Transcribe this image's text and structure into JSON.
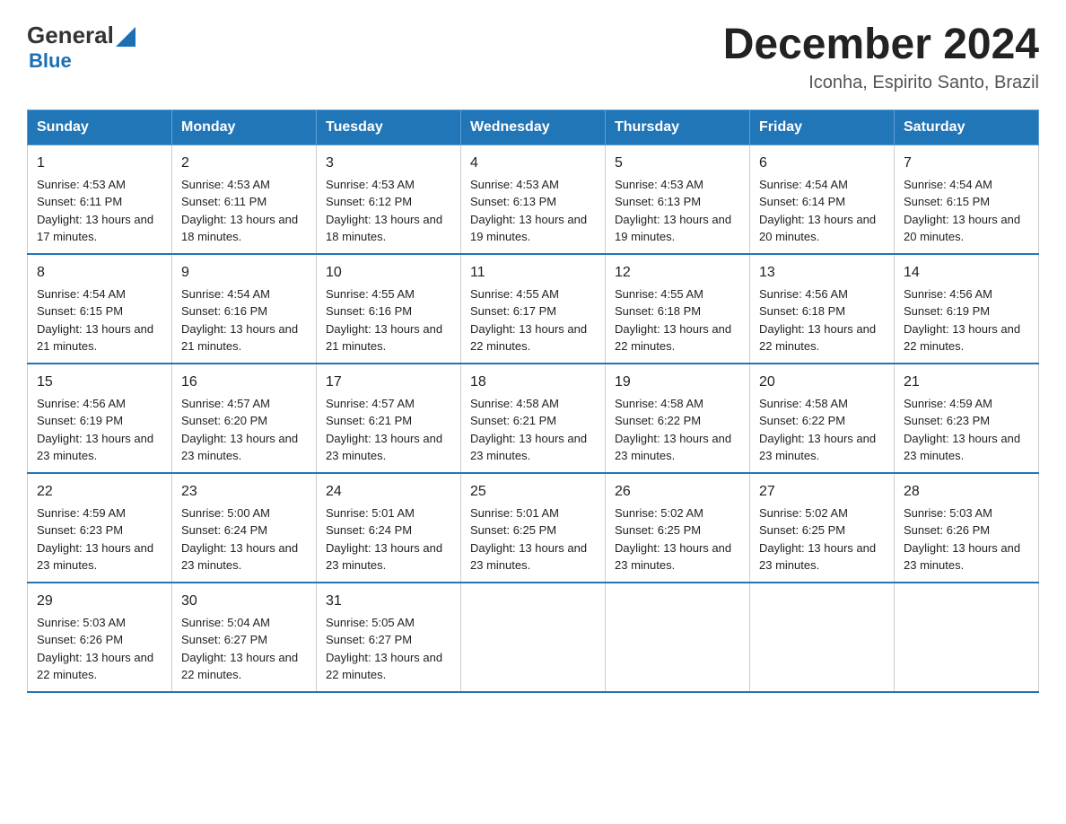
{
  "logo": {
    "general": "General",
    "blue": "Blue",
    "triangle": "▲"
  },
  "header": {
    "month_year": "December 2024",
    "location": "Iconha, Espirito Santo, Brazil"
  },
  "days_of_week": [
    "Sunday",
    "Monday",
    "Tuesday",
    "Wednesday",
    "Thursday",
    "Friday",
    "Saturday"
  ],
  "weeks": [
    [
      {
        "day": "1",
        "sunrise": "4:53 AM",
        "sunset": "6:11 PM",
        "daylight": "13 hours and 17 minutes."
      },
      {
        "day": "2",
        "sunrise": "4:53 AM",
        "sunset": "6:11 PM",
        "daylight": "13 hours and 18 minutes."
      },
      {
        "day": "3",
        "sunrise": "4:53 AM",
        "sunset": "6:12 PM",
        "daylight": "13 hours and 18 minutes."
      },
      {
        "day": "4",
        "sunrise": "4:53 AM",
        "sunset": "6:13 PM",
        "daylight": "13 hours and 19 minutes."
      },
      {
        "day": "5",
        "sunrise": "4:53 AM",
        "sunset": "6:13 PM",
        "daylight": "13 hours and 19 minutes."
      },
      {
        "day": "6",
        "sunrise": "4:54 AM",
        "sunset": "6:14 PM",
        "daylight": "13 hours and 20 minutes."
      },
      {
        "day": "7",
        "sunrise": "4:54 AM",
        "sunset": "6:15 PM",
        "daylight": "13 hours and 20 minutes."
      }
    ],
    [
      {
        "day": "8",
        "sunrise": "4:54 AM",
        "sunset": "6:15 PM",
        "daylight": "13 hours and 21 minutes."
      },
      {
        "day": "9",
        "sunrise": "4:54 AM",
        "sunset": "6:16 PM",
        "daylight": "13 hours and 21 minutes."
      },
      {
        "day": "10",
        "sunrise": "4:55 AM",
        "sunset": "6:16 PM",
        "daylight": "13 hours and 21 minutes."
      },
      {
        "day": "11",
        "sunrise": "4:55 AM",
        "sunset": "6:17 PM",
        "daylight": "13 hours and 22 minutes."
      },
      {
        "day": "12",
        "sunrise": "4:55 AM",
        "sunset": "6:18 PM",
        "daylight": "13 hours and 22 minutes."
      },
      {
        "day": "13",
        "sunrise": "4:56 AM",
        "sunset": "6:18 PM",
        "daylight": "13 hours and 22 minutes."
      },
      {
        "day": "14",
        "sunrise": "4:56 AM",
        "sunset": "6:19 PM",
        "daylight": "13 hours and 22 minutes."
      }
    ],
    [
      {
        "day": "15",
        "sunrise": "4:56 AM",
        "sunset": "6:19 PM",
        "daylight": "13 hours and 23 minutes."
      },
      {
        "day": "16",
        "sunrise": "4:57 AM",
        "sunset": "6:20 PM",
        "daylight": "13 hours and 23 minutes."
      },
      {
        "day": "17",
        "sunrise": "4:57 AM",
        "sunset": "6:21 PM",
        "daylight": "13 hours and 23 minutes."
      },
      {
        "day": "18",
        "sunrise": "4:58 AM",
        "sunset": "6:21 PM",
        "daylight": "13 hours and 23 minutes."
      },
      {
        "day": "19",
        "sunrise": "4:58 AM",
        "sunset": "6:22 PM",
        "daylight": "13 hours and 23 minutes."
      },
      {
        "day": "20",
        "sunrise": "4:58 AM",
        "sunset": "6:22 PM",
        "daylight": "13 hours and 23 minutes."
      },
      {
        "day": "21",
        "sunrise": "4:59 AM",
        "sunset": "6:23 PM",
        "daylight": "13 hours and 23 minutes."
      }
    ],
    [
      {
        "day": "22",
        "sunrise": "4:59 AM",
        "sunset": "6:23 PM",
        "daylight": "13 hours and 23 minutes."
      },
      {
        "day": "23",
        "sunrise": "5:00 AM",
        "sunset": "6:24 PM",
        "daylight": "13 hours and 23 minutes."
      },
      {
        "day": "24",
        "sunrise": "5:01 AM",
        "sunset": "6:24 PM",
        "daylight": "13 hours and 23 minutes."
      },
      {
        "day": "25",
        "sunrise": "5:01 AM",
        "sunset": "6:25 PM",
        "daylight": "13 hours and 23 minutes."
      },
      {
        "day": "26",
        "sunrise": "5:02 AM",
        "sunset": "6:25 PM",
        "daylight": "13 hours and 23 minutes."
      },
      {
        "day": "27",
        "sunrise": "5:02 AM",
        "sunset": "6:25 PM",
        "daylight": "13 hours and 23 minutes."
      },
      {
        "day": "28",
        "sunrise": "5:03 AM",
        "sunset": "6:26 PM",
        "daylight": "13 hours and 23 minutes."
      }
    ],
    [
      {
        "day": "29",
        "sunrise": "5:03 AM",
        "sunset": "6:26 PM",
        "daylight": "13 hours and 22 minutes."
      },
      {
        "day": "30",
        "sunrise": "5:04 AM",
        "sunset": "6:27 PM",
        "daylight": "13 hours and 22 minutes."
      },
      {
        "day": "31",
        "sunrise": "5:05 AM",
        "sunset": "6:27 PM",
        "daylight": "13 hours and 22 minutes."
      },
      null,
      null,
      null,
      null
    ]
  ]
}
